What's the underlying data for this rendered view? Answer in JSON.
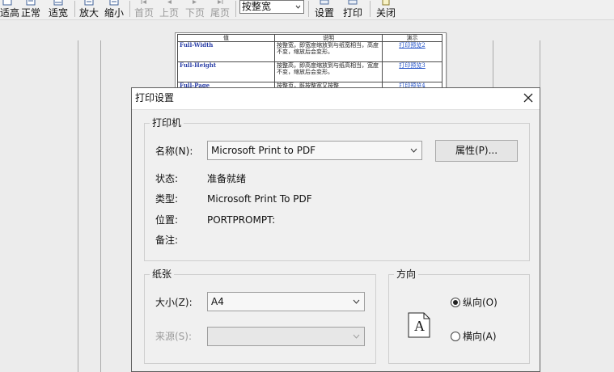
{
  "toolbar": {
    "items": [
      {
        "label": "适高",
        "icon": "fit-height-icon",
        "disabled": false
      },
      {
        "label": "正常",
        "icon": "normal-page-icon",
        "disabled": false
      },
      {
        "label": "适宽",
        "icon": "fit-width-icon",
        "disabled": false
      },
      {
        "label": "放大",
        "icon": "zoom-in-icon",
        "disabled": false
      },
      {
        "label": "缩小",
        "icon": "zoom-out-icon",
        "disabled": false
      },
      {
        "label": "首页",
        "icon": "first-page-icon",
        "disabled": true
      },
      {
        "label": "上页",
        "icon": "previous-page-icon",
        "disabled": true
      },
      {
        "label": "下页",
        "icon": "next-page-icon",
        "disabled": true
      },
      {
        "label": "尾页",
        "icon": "last-page-icon",
        "disabled": true
      },
      {
        "label": "设置",
        "icon": "settings-printer-icon",
        "disabled": false
      },
      {
        "label": "打印",
        "icon": "printer-icon",
        "disabled": false
      },
      {
        "label": "关闭",
        "icon": "close-window-icon",
        "disabled": false
      }
    ],
    "zoom_value": "按整宽"
  },
  "preview": {
    "table": {
      "headers": [
        "值",
        "说明",
        "演示"
      ],
      "rows": [
        {
          "value": "Full-Width",
          "desc": "按整宽，即宽度缩放到与纸宽相当，高度不变，缩放后会变形。",
          "demo": "打印预览2"
        },
        {
          "value": "Full-Height",
          "desc": "按整高，即高度缩放到与纸高相当，宽度不变，缩放后会变形。",
          "demo": "打印预览3"
        },
        {
          "value": "Full-Page",
          "desc": "按整页，既按整宽又按整",
          "demo": "打印预览4"
        }
      ]
    }
  },
  "dialog": {
    "title": "打印设置",
    "printer_group": {
      "label": "打印机",
      "name_label": "名称(N):",
      "name_value": "Microsoft Print to PDF",
      "properties_button": "属性(P)...",
      "status_label": "状态:",
      "status_value": "准备就绪",
      "type_label": "类型:",
      "type_value": "Microsoft Print To PDF",
      "location_label": "位置:",
      "location_value": "PORTPROMPT:",
      "comment_label": "备注:"
    },
    "paper_group": {
      "label": "纸张",
      "size_label": "大小(Z):",
      "size_value": "A4",
      "source_label": "来源(S):",
      "source_value": ""
    },
    "orientation_group": {
      "label": "方向",
      "portrait_label": "纵向(O)",
      "landscape_label": "横向(A)",
      "selected": "portrait",
      "icon_letter": "A"
    }
  },
  "colors": {
    "window_bg": "#f0f0f0",
    "preview_bg": "#ececec",
    "border": "#5f5f5f",
    "link_blue": "#2050c8"
  }
}
